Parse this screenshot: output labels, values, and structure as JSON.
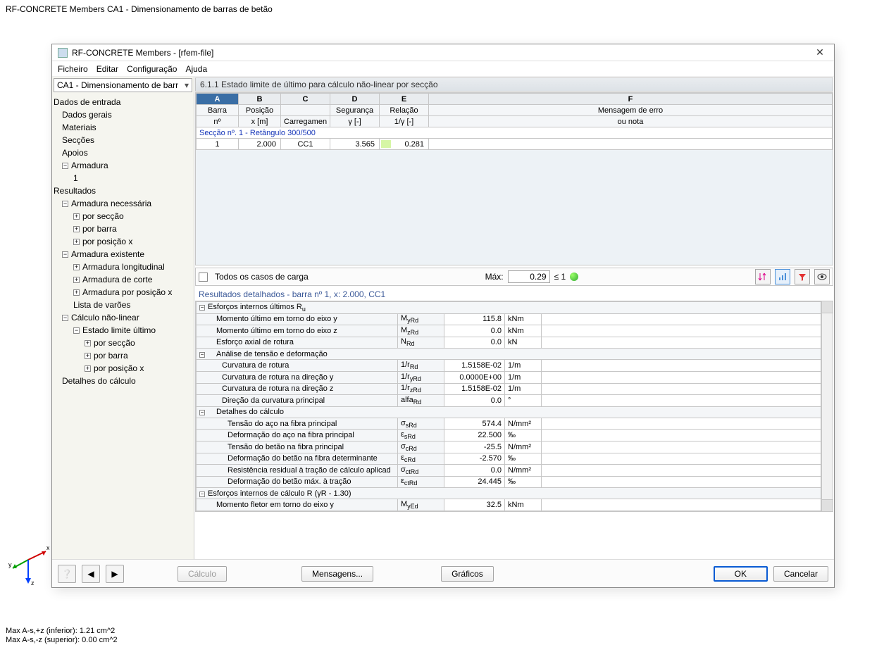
{
  "app_title": "RF-CONCRETE Members CA1 - Dimensionamento de barras de betão",
  "footer": {
    "line1": "Max A-s,+z (inferior): 1.21 cm^2",
    "line2": "Max A-s,-z (superior): 0.00 cm^2"
  },
  "window": {
    "title": "RF-CONCRETE Members - [rfem-file]"
  },
  "menu": {
    "ficheiro": "Ficheiro",
    "editar": "Editar",
    "config": "Configuração",
    "ajuda": "Ajuda"
  },
  "nav": {
    "combo": "CA1 - Dimensionamento de barr",
    "tree": {
      "dados_entrada": "Dados de entrada",
      "dados_gerais": "Dados gerais",
      "materiais": "Materiais",
      "seccoes": "Secções",
      "apoios": "Apoios",
      "armadura": "Armadura",
      "arm1": "1",
      "resultados": "Resultados",
      "arm_nec": "Armadura necessária",
      "por_seccao": "por secção",
      "por_barra": "por barra",
      "por_posx": "por posição x",
      "arm_exist": "Armadura existente",
      "arm_long": "Armadura longitudinal",
      "arm_corte": "Armadura de corte",
      "arm_posx": "Armadura por posição x",
      "lista_varoes": "Lista de varões",
      "calc_nl": "Cálculo não-linear",
      "slu": "Estado limite último",
      "det_calc": "Detalhes do cálculo"
    }
  },
  "section_title": "6.1.1 Estado limite de último para cálculo não-linear por secção",
  "grid": {
    "colletters": [
      "A",
      "B",
      "C",
      "D",
      "E",
      "F"
    ],
    "headers1": {
      "a": "Barra",
      "b": "Posição",
      "c": "",
      "d": "Segurança",
      "e": "Relação",
      "f": "Mensagem de erro"
    },
    "headers2": {
      "a": "nº",
      "b": "x [m]",
      "c": "Carregamen",
      "d": "γ [-]",
      "e": "1/γ [-]",
      "f": "ou nota"
    },
    "sectrow": "Secção nº. 1 - Retângulo 300/500",
    "row": {
      "a": "1",
      "b": "2.000",
      "c": "CC1",
      "d": "3.565",
      "e": "0.281",
      "f": ""
    }
  },
  "optbar": {
    "chk_label": "Todos os casos de carga",
    "max_label": "Máx:",
    "max_value": "0.29",
    "max_limit": "≤ 1"
  },
  "detail_title": "Resultados detalhados  -  barra nº 1,   x: 2.000, CC1",
  "detail": {
    "grp_ru": "Esforços internos últimos R",
    "mom_y": {
      "lbl": "Momento último em torno do eixo y",
      "sym": "M",
      "sub": "yRd",
      "val": "115.8",
      "unit": "kNm"
    },
    "mom_z": {
      "lbl": "Momento último em torno do eixo z",
      "sym": "M",
      "sub": "zRd",
      "val": "0.0",
      "unit": "kNm"
    },
    "ax_rot": {
      "lbl": "Esforço axial de rotura",
      "sym": "N",
      "sub": "Rd",
      "val": "0.0",
      "unit": "kN"
    },
    "grp_def": "Análise de tensão e deformação",
    "curv_rot": {
      "lbl": "Curvatura de rotura",
      "sym": "1/r",
      "sub": "Rd",
      "val": "1.5158E-02",
      "unit": "1/m"
    },
    "curv_y": {
      "lbl": "Curvatura de rotura na direção y",
      "sym": "1/r",
      "sub": "yRd",
      "val": "0.0000E+00",
      "unit": "1/m"
    },
    "curv_z": {
      "lbl": "Curvatura de rotura na direção z",
      "sym": "1/r",
      "sub": "zRd",
      "val": "1.5158E-02",
      "unit": "1/m"
    },
    "dir_curv": {
      "lbl": "Direção da curvatura principal",
      "sym": "alfa",
      "sub": "Rd",
      "val": "0.0",
      "unit": "°"
    },
    "grp_det": "Detalhes do cálculo",
    "tens_aco": {
      "lbl": "Tensão do aço na fibra principal",
      "sym": "σ",
      "sub": "sRd",
      "val": "574.4",
      "unit": "N/mm²"
    },
    "def_aco": {
      "lbl": "Deformação do aço na fibra principal",
      "sym": "ε",
      "sub": "sRd",
      "val": "22.500",
      "unit": "‰"
    },
    "tens_bet": {
      "lbl": "Tensão do betão na fibra principal",
      "sym": "σ",
      "sub": "cRd",
      "val": "-25.5",
      "unit": "N/mm²"
    },
    "def_bet": {
      "lbl": "Deformação do betão na fibra determinante",
      "sym": "ε",
      "sub": "cRd",
      "val": "-2.570",
      "unit": "‰"
    },
    "res_trac": {
      "lbl": "Resistência residual à tração de cálculo aplicad",
      "sym": "σ",
      "sub": "ctRd",
      "val": "0.0",
      "unit": "N/mm²"
    },
    "def_max": {
      "lbl": "Deformação do betão máx. à tração",
      "sym": "ε",
      "sub": "ctRd",
      "val": "24.445",
      "unit": "‰"
    },
    "grp_calc": "Esforços internos de cálculo R   (γR - 1.30)",
    "mom_yed": {
      "lbl": "Momento fletor em torno do eixo y",
      "sym": "M",
      "sub": "yEd",
      "val": "32.5",
      "unit": "kNm"
    }
  },
  "buttons": {
    "calculo": "Cálculo",
    "mensagens": "Mensagens...",
    "graficos": "Gráficos",
    "ok": "OK",
    "cancelar": "Cancelar"
  }
}
